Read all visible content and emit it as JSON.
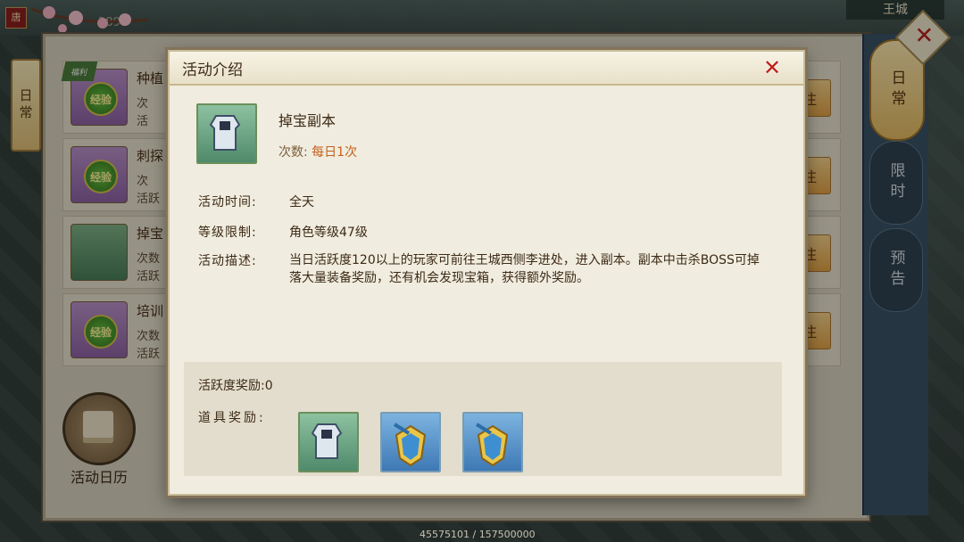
{
  "background": {
    "tang_tag": "唐",
    "counter": "2898",
    "king_city": "王城",
    "exp_counter": "45575101 / 157500000"
  },
  "under_panel": {
    "left_tab": "日常",
    "rows": [
      {
        "icon": "exp",
        "icon_label": "经验",
        "name": "种植",
        "sub1": "次",
        "sub2": "活",
        "button": "注",
        "corner_tag": "福利"
      },
      {
        "icon": "exp",
        "icon_label": "经验",
        "name": "刺探",
        "sub1": "次",
        "sub2": "活跃",
        "button": "注"
      },
      {
        "icon": "armor",
        "icon_label": "",
        "name": "掉宝",
        "sub1": "次数",
        "sub2": "活跃",
        "button": "注"
      },
      {
        "icon": "exp",
        "icon_label": "经验",
        "name": "培训",
        "sub1": "次数",
        "sub2": "活跃",
        "button": "注"
      }
    ],
    "calendar_label": "活动日历",
    "right_tabs": [
      "日常",
      "限时",
      "预告"
    ]
  },
  "dialog": {
    "title": "活动介绍",
    "close_symbol": "✕",
    "dungeon_name": "掉宝副本",
    "count_label": "次数:",
    "count_value": "每日1次",
    "time_label": "活动时间:",
    "time_value": "全天",
    "level_label": "等级限制:",
    "level_value": "角色等级47级",
    "desc_label": "活动描述:",
    "desc_value": "当日活跃度120以上的玩家可前往王城西侧李进处，进入副本。副本中击杀BOSS可掉落大量装备奖励，还有机会发现宝箱，获得额外奖励。",
    "active_reward_label": "活跃度奖励:",
    "active_reward_value": "0",
    "item_reward_label": "道具奖励:",
    "items": [
      "armor-icon",
      "amulet-icon",
      "amulet-icon"
    ]
  },
  "colors": {
    "dialog_bg": "#f0ecdf",
    "accent_orange": "#c4601b",
    "close_red": "#c0211b",
    "tab_gold": "#e5bb62"
  }
}
